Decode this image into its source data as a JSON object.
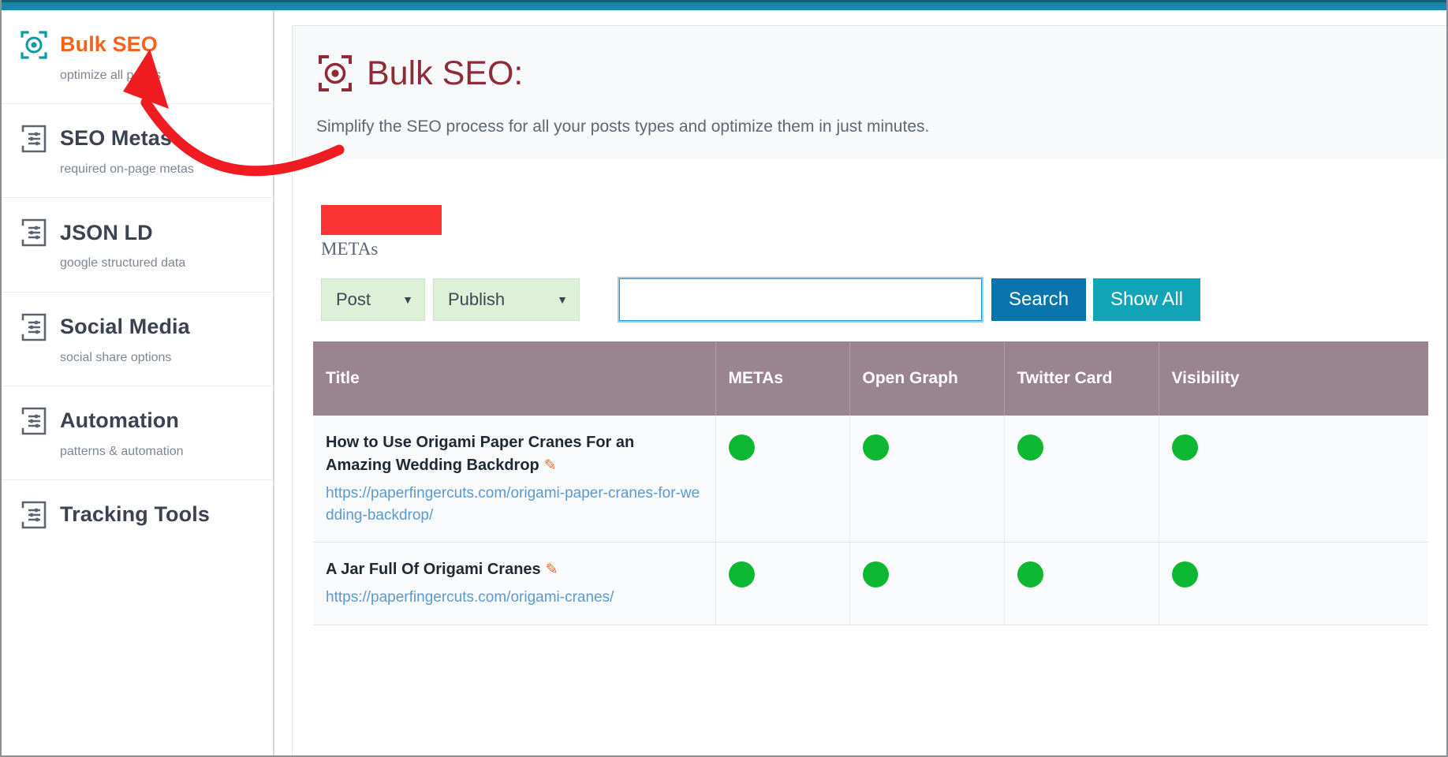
{
  "colors": {
    "topbar": "#1b87a8",
    "accent_orange": "#f2641e",
    "title_maroon": "#8f2b37",
    "table_header": "#9a8490",
    "status_green": "#0cb832",
    "redaction_red": "#fa3434",
    "search_button": "#0a74ac",
    "showall_button": "#12a5b8",
    "arrow_red": "#ef1c22"
  },
  "sidebar": {
    "items": [
      {
        "label": "Bulk SEO",
        "sub": "optimize all pages",
        "icon": "target-document-icon",
        "active": true
      },
      {
        "label": "SEO Metas",
        "sub": "required on-page metas",
        "icon": "sliders-document-icon",
        "active": false
      },
      {
        "label": "JSON LD",
        "sub": "google structured data",
        "icon": "sliders-document-icon",
        "active": false
      },
      {
        "label": "Social Media",
        "sub": "social share options",
        "icon": "sliders-document-icon",
        "active": false
      },
      {
        "label": "Automation",
        "sub": "patterns & automation",
        "icon": "sliders-document-icon",
        "active": false
      },
      {
        "label": "Tracking Tools",
        "sub": "",
        "icon": "sliders-document-icon",
        "active": false
      }
    ]
  },
  "header": {
    "title": "Bulk SEO:",
    "icon": "target-document-icon",
    "description": "Simplify the SEO process for all your posts types and optimize them in just minutes."
  },
  "stats": {
    "metas_label": "METAs",
    "metas_value_redacted": true
  },
  "filters": {
    "post_type": {
      "value": "Post",
      "caret": "▼"
    },
    "status": {
      "value": "Publish",
      "caret": "▼"
    },
    "search": {
      "value": "",
      "placeholder": ""
    },
    "search_button": "Search",
    "show_all_button": "Show All"
  },
  "table": {
    "columns": [
      "Title",
      "METAs",
      "Open Graph",
      "Twitter Card",
      "Visibility"
    ],
    "rows": [
      {
        "title": "How to Use Origami Paper Cranes For an Amazing Wedding Backdrop",
        "edit_icon": "✎",
        "url": "https://paperfingercuts.com/origami-paper-cranes-for-wedding-backdrop/",
        "metas": "ok",
        "open_graph": "ok",
        "twitter_card": "ok",
        "visibility": "ok"
      },
      {
        "title": "A Jar Full Of Origami Cranes",
        "edit_icon": "✎",
        "url": "https://paperfingercuts.com/origami-cranes/",
        "metas": "ok",
        "open_graph": "ok",
        "twitter_card": "ok",
        "visibility": "ok"
      }
    ]
  },
  "annotation": {
    "type": "curved-arrow",
    "points_to": "sidebar-item-bulk-seo"
  }
}
